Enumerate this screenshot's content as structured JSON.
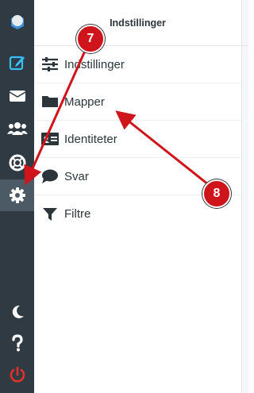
{
  "header": {
    "title": "Indstillinger"
  },
  "sidebar": {
    "buttons": [
      {
        "icon": "logo-icon"
      },
      {
        "icon": "compose-icon"
      },
      {
        "icon": "mail-icon"
      },
      {
        "icon": "contacts-icon"
      },
      {
        "icon": "help-ring-icon"
      },
      {
        "icon": "gear-icon",
        "active": true
      },
      {
        "icon": "moon-icon"
      },
      {
        "icon": "question-icon"
      },
      {
        "icon": "power-icon"
      }
    ]
  },
  "menu": {
    "items": [
      {
        "label": "Indstillinger",
        "icon": "sliders-icon"
      },
      {
        "label": "Mapper",
        "icon": "folder-icon"
      },
      {
        "label": "Identiteter",
        "icon": "id-card-icon"
      },
      {
        "label": "Svar",
        "icon": "chat-bubble-icon"
      },
      {
        "label": "Filtre",
        "icon": "filter-icon"
      }
    ]
  },
  "annotations": [
    {
      "label": "7"
    },
    {
      "label": "8"
    }
  ],
  "colors": {
    "rail": "#2f3a42",
    "accent": "#37beff",
    "annotation": "#d0141c",
    "power": "#e0322b"
  }
}
